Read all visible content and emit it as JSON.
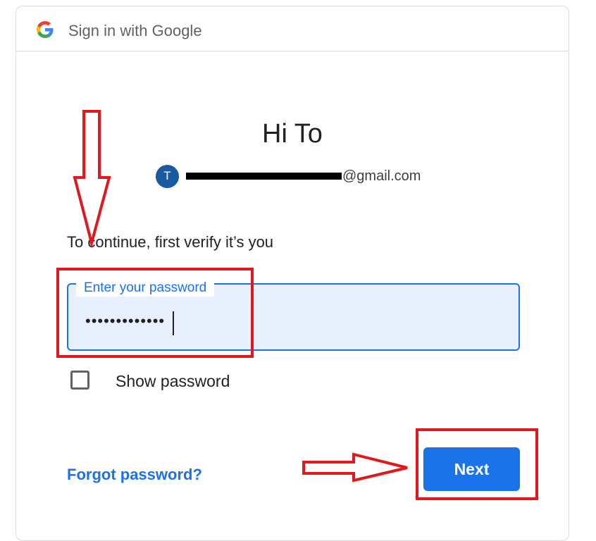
{
  "header": {
    "title": "Sign in with Google",
    "logo_icon": "google-g-logo-icon"
  },
  "greeting": "Hi To",
  "account": {
    "avatar_initial": "T",
    "email_visible_suffix": "@gmail.com"
  },
  "instruction": "To continue, first verify it’s you",
  "password": {
    "label": "Enter your password",
    "masked_value": "•••••••••••••"
  },
  "show_password": {
    "label": "Show password",
    "checked": false
  },
  "forgot_link": "Forgot password?",
  "next_button": "Next",
  "colors": {
    "accent": "#1a73e8",
    "field_bg": "#e8f0fe",
    "annotation_red": "#e3171e",
    "avatar": "#1a5aa0"
  }
}
